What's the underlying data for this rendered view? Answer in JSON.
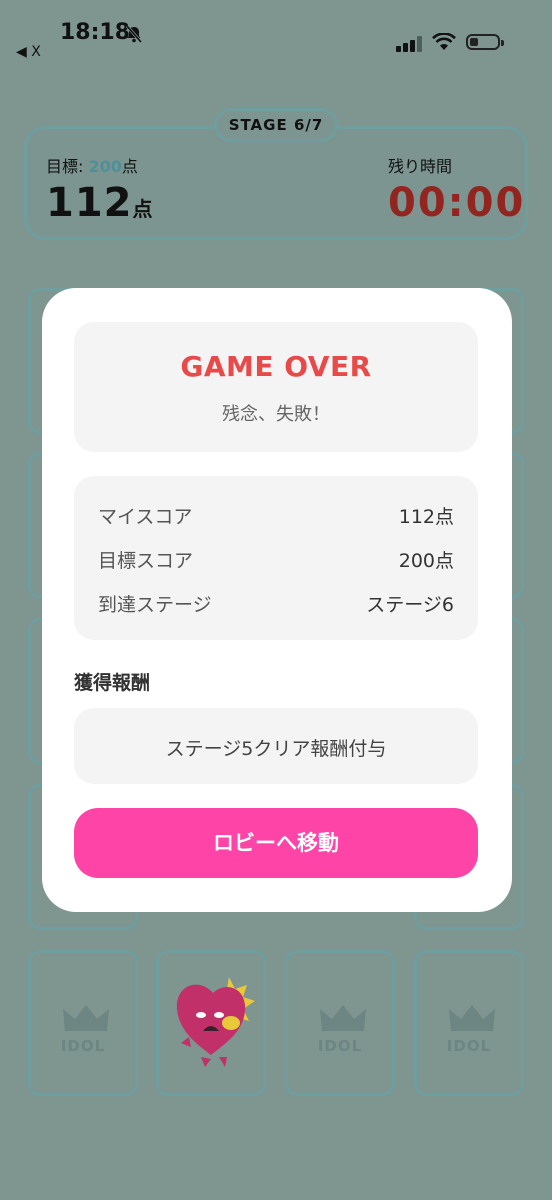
{
  "status_bar": {
    "time": "18:18",
    "back_label": "◀ X"
  },
  "game_header": {
    "stage": "STAGE 6/7",
    "target_prefix": "目標: ",
    "target_value": "200",
    "target_unit": "点",
    "current_score": "112",
    "current_unit": "点",
    "time_label": "残り時間",
    "time_value": "00:00"
  },
  "cards": {
    "idol_label": "IDOL"
  },
  "modal": {
    "title": "GAME OVER",
    "subtitle": "残念、失敗！",
    "stats": [
      {
        "label": "マイスコア",
        "value": "112点"
      },
      {
        "label": "目標スコア",
        "value": "200点"
      },
      {
        "label": "到達ステージ",
        "value": "ステージ6"
      }
    ],
    "reward_heading": "獲得報酬",
    "reward_text": "ステージ5クリア報酬付与",
    "lobby_button": "ロビーへ移動"
  },
  "colors": {
    "overlay_bg": "#7e9590",
    "game_over_red": "#e84a4a",
    "timer_red": "#922520",
    "button_pink": "#ff44a8"
  },
  "icons": [
    "bell-slash-icon",
    "signal-icon",
    "wifi-icon",
    "battery-icon",
    "crown-icon",
    "creature-character-icon"
  ]
}
